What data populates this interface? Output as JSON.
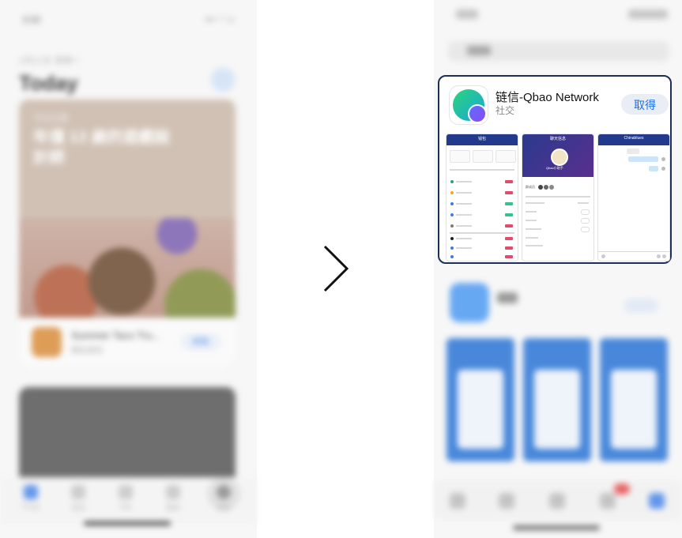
{
  "left_screen": {
    "status_time": "3:00",
    "date": "1月21日 星期一",
    "title": "Today",
    "story_label": "今日主题",
    "story_headline": "年僅 13 歲的遊戲設計師",
    "featured_game": {
      "name": "Summer Taco Tru...",
      "subtitle": "模拟游戏",
      "get_label": "获取"
    },
    "tabs": [
      "Today",
      "游戏",
      "App",
      "更新",
      "搜索"
    ],
    "active_tab": "Today"
  },
  "arrow": {
    "icon": "chevron-right-icon"
  },
  "right_screen": {
    "search_result": {
      "app_name": "链信-Qbao Network",
      "category": "社交",
      "get_label": "取得",
      "screenshots": [
        {
          "title": "钱包"
        },
        {
          "title": "聊天信息",
          "username": "Qbao小助手",
          "members_label": "群成员"
        },
        {
          "title": "Chinablues"
        }
      ]
    }
  }
}
